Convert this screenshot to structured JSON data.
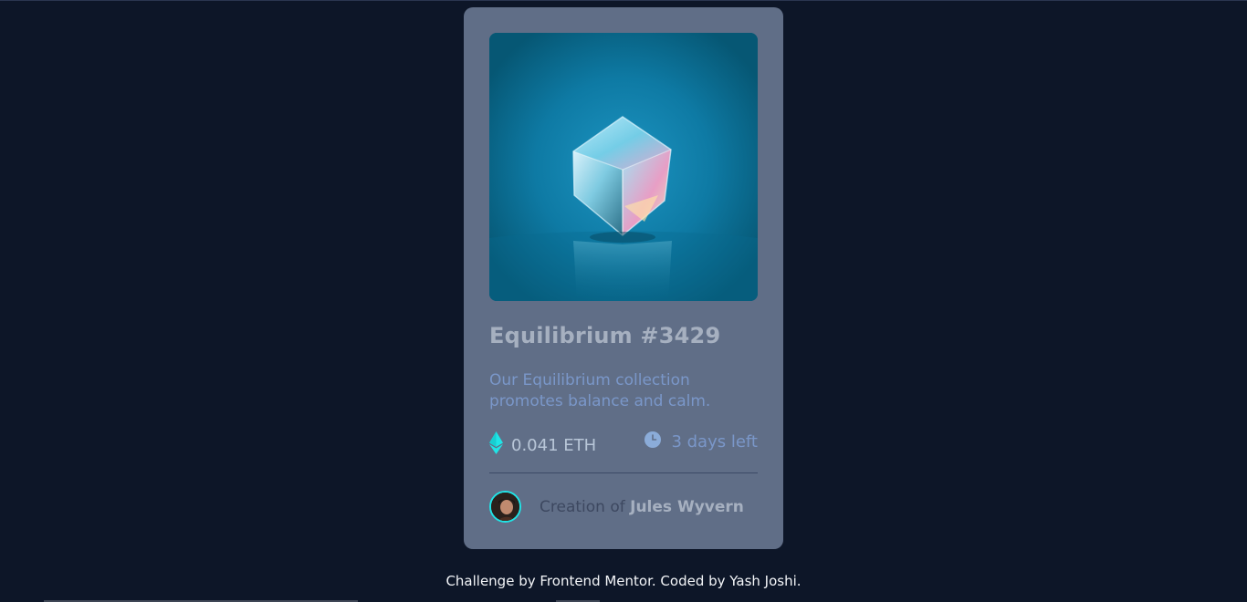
{
  "card": {
    "title": "Equilibrium #3429",
    "description": "Our Equilibrium collection promotes balance and calm.",
    "price": "0.041 ETH",
    "time_left": "3 days left",
    "creator_prefix": "Creation of",
    "creator_name": "Jules Wyvern",
    "image_icon": "equilibrium-cube-image",
    "eth_icon": "ethereum-icon",
    "clock_icon": "clock-icon",
    "colors": {
      "background": "#0d1628",
      "card": "#606e87",
      "accent": "#20e4e6",
      "soft_blue": "#7a97c9"
    }
  },
  "attribution": {
    "prefix": "Challenge by",
    "brand": "Frontend Mentor",
    "middle": ". Coded by",
    "author": "Yash Joshi",
    "suffix": "."
  }
}
